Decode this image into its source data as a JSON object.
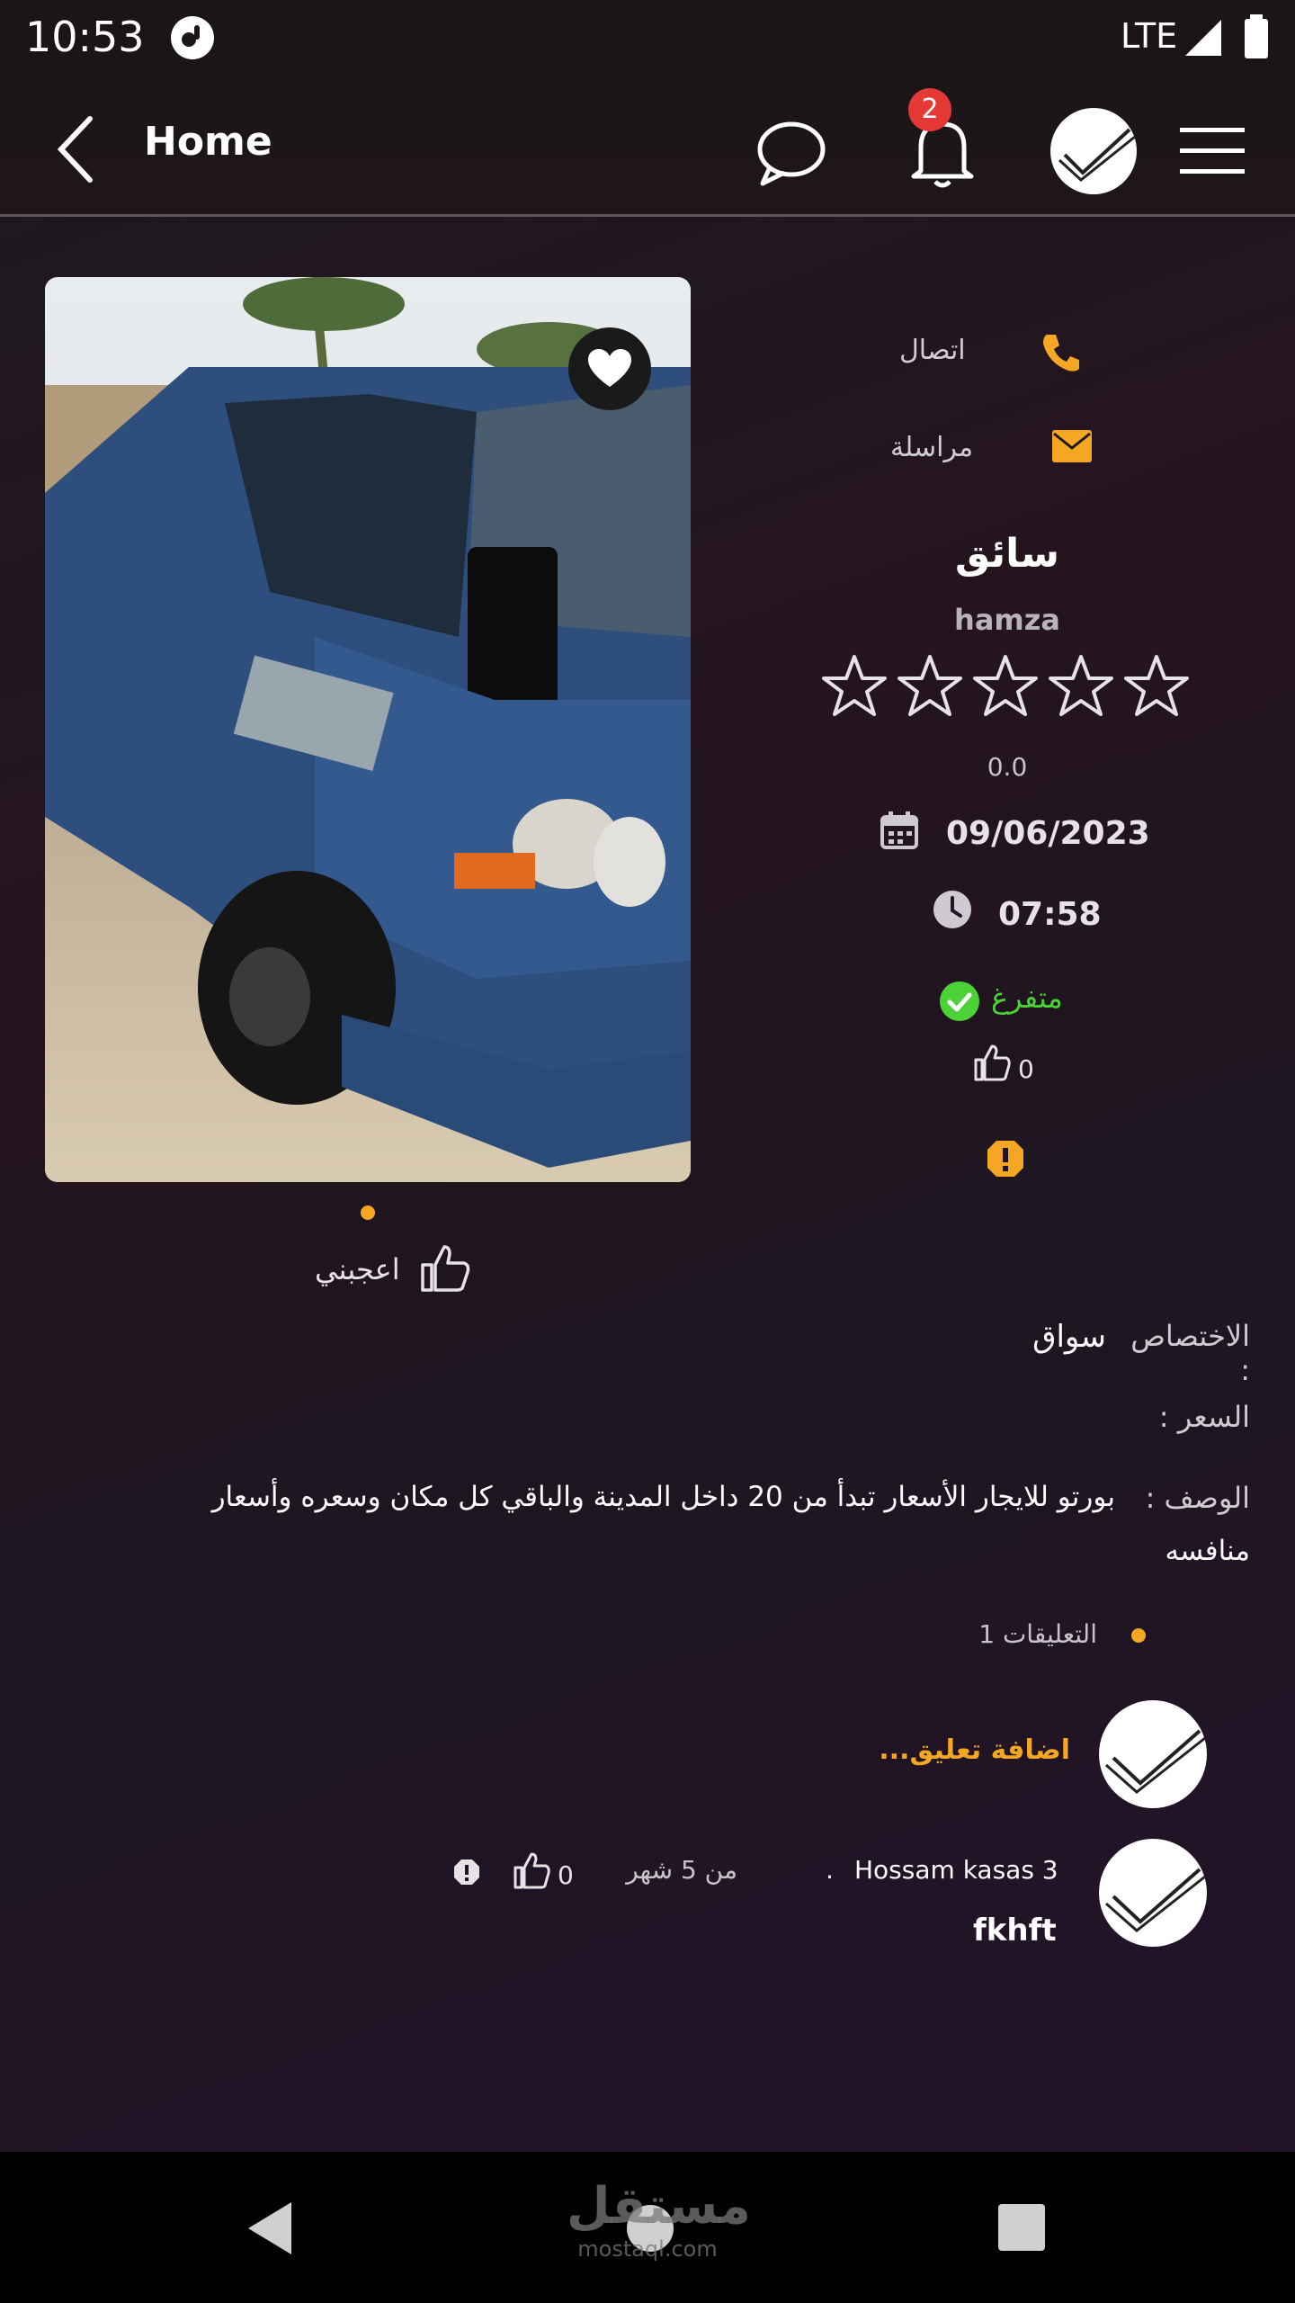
{
  "status_bar": {
    "time": "10:53",
    "network": "LTE"
  },
  "app_bar": {
    "title": "Home",
    "notification_count": "2",
    "icons": [
      "back-icon",
      "chat-icon",
      "bell-icon",
      "avatar",
      "menu-icon"
    ]
  },
  "listing": {
    "contact": {
      "call_label": "اتصال",
      "message_label": "مراسلة"
    },
    "role": "سائق",
    "username": "hamza",
    "rating_value": "0.0",
    "rating_stars": 0,
    "date": "09/06/2023",
    "time": "07:58",
    "availability": "متفرغ",
    "likes_count": "0",
    "like_button_label": "اعجبني",
    "specialty_label": "الاختصاص :",
    "specialty_value": "سواق",
    "price_label": "السعر :",
    "price_value": "",
    "description_label": "الوصف :",
    "description_line1": "بورتو للايجار الأسعار تبدأ من 20 داخل المدينة والباقي كل مكان وسعره وأسعار",
    "description_line2": "منافسه"
  },
  "comments": {
    "header": "التعليقات 1",
    "add_placeholder": "اضافة تعليق...",
    "items": [
      {
        "author": "Hossam kasas 3",
        "time_ago": "من 5 شهر",
        "likes": "0",
        "text": "fkhft"
      }
    ]
  },
  "colors": {
    "accent": "#f5a623",
    "success": "#4cd137",
    "badge": "#e53935"
  },
  "watermark": {
    "logo_text": "مستقل",
    "url": "mostaql.com"
  }
}
